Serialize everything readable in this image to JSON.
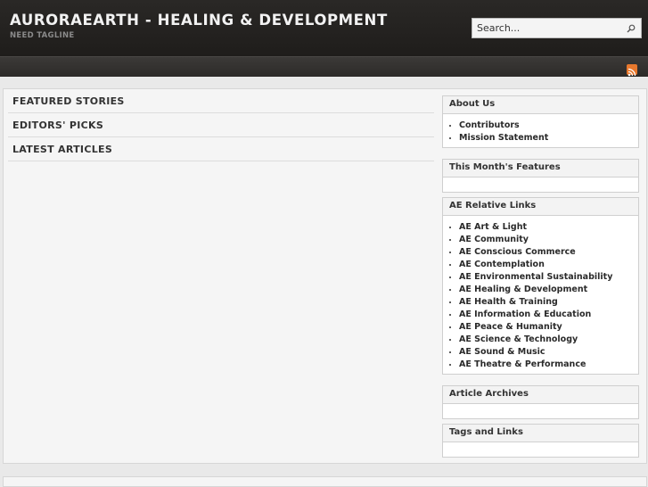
{
  "site": {
    "title": "AURORAEARTH - HEALING & DEVELOPMENT",
    "tagline": "NEED TAGLINE"
  },
  "search": {
    "placeholder": "Search..."
  },
  "nav": {
    "items": []
  },
  "icons": {
    "search": "search-icon",
    "rss": "rss-icon"
  },
  "colors": {
    "header_bg": "#242220",
    "rss": "#e8782d",
    "page_bg": "#e9e9e9"
  },
  "content": {
    "sections": [
      {
        "label": "FEATURED STORIES"
      },
      {
        "label": "EDITORS' PICKS"
      },
      {
        "label": "LATEST ARTICLES"
      }
    ]
  },
  "sidebar": {
    "about": {
      "title": "About Us",
      "items": [
        {
          "label": "Contributors"
        },
        {
          "label": "Mission Statement"
        }
      ]
    },
    "features": {
      "title": "This Month's Features"
    },
    "links": {
      "title": "AE Relative Links",
      "items": [
        {
          "label": "AE Art & Light"
        },
        {
          "label": "AE Community"
        },
        {
          "label": "AE Conscious Commerce"
        },
        {
          "label": "AE Contemplation"
        },
        {
          "label": "AE Environmental Sustainability"
        },
        {
          "label": "AE Healing & Development"
        },
        {
          "label": "AE Health & Training"
        },
        {
          "label": "AE Information & Education"
        },
        {
          "label": "AE Peace & Humanity"
        },
        {
          "label": "AE Science & Technology"
        },
        {
          "label": "AE Sound & Music"
        },
        {
          "label": "AE Theatre & Performance"
        }
      ]
    },
    "archives": {
      "title": "Article Archives"
    },
    "tags": {
      "title": "Tags and Links"
    }
  }
}
